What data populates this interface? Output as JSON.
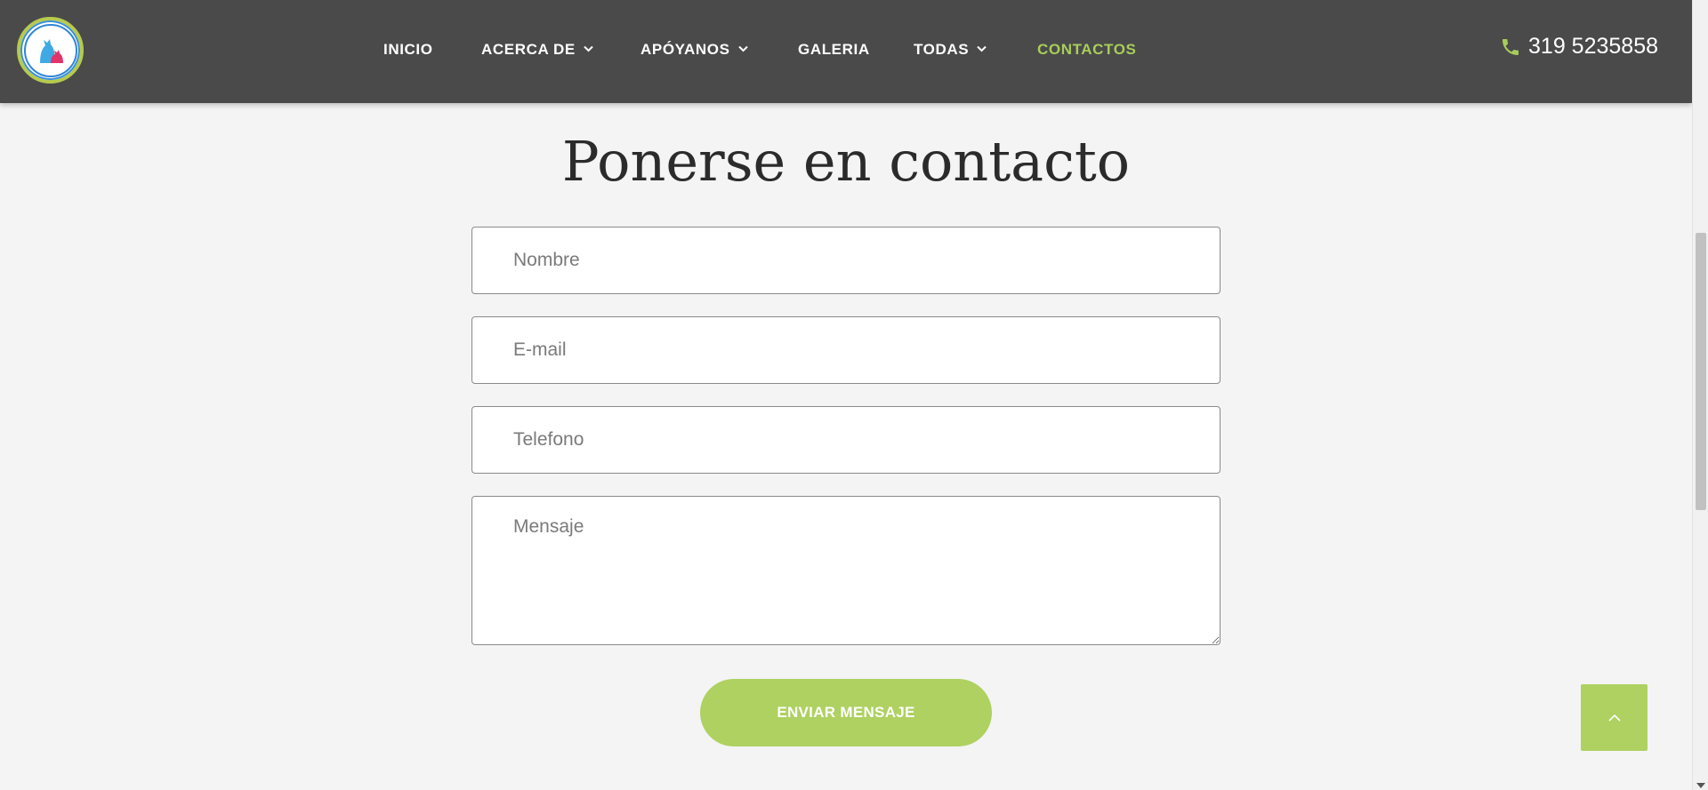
{
  "header": {
    "logo_alt": "dog-and-cat-logo",
    "nav": [
      {
        "label": "INICIO",
        "dropdown": false,
        "active": false
      },
      {
        "label": "ACERCA DE",
        "dropdown": true,
        "active": false
      },
      {
        "label": "APÓYANOS",
        "dropdown": true,
        "active": false
      },
      {
        "label": "GALERIA",
        "dropdown": false,
        "active": false
      },
      {
        "label": "TODAS",
        "dropdown": true,
        "active": false
      },
      {
        "label": "CONTACTOS",
        "dropdown": false,
        "active": true
      }
    ],
    "phone": "319 5235858",
    "phone_icon": "phone-icon"
  },
  "contact": {
    "title": "Ponerse en contacto",
    "name_placeholder": "Nombre",
    "email_placeholder": "E-mail",
    "phone_placeholder": "Telefono",
    "message_placeholder": "Mensaje",
    "submit_label": "ENVIAR MENSAJE"
  },
  "scroll_top_icon": "chevron-up-icon",
  "colors": {
    "header_bg": "#4a4a4a",
    "accent": "#aed161",
    "active_nav": "#a8cd5a",
    "page_bg": "#f4f4f4"
  }
}
